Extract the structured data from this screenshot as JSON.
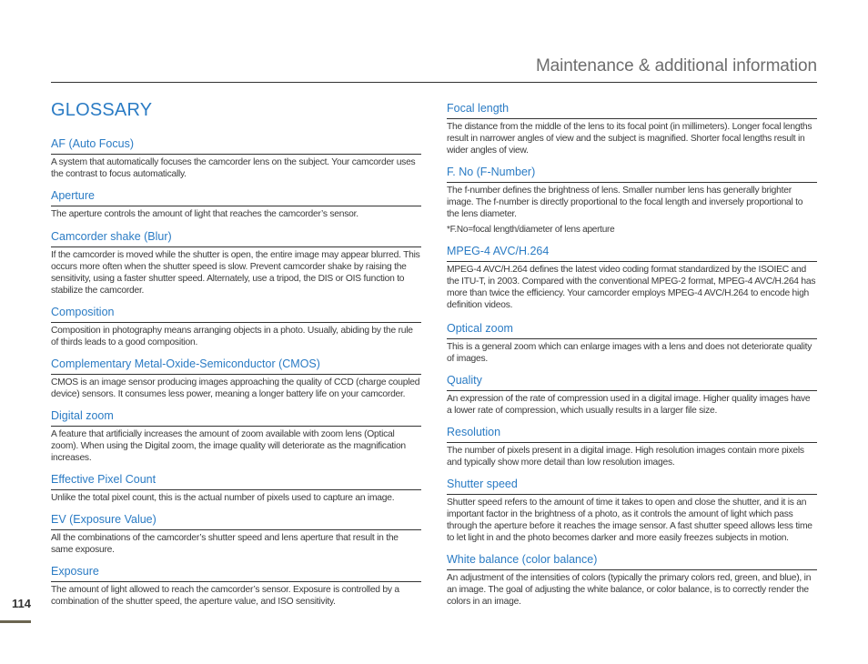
{
  "header": {
    "section_title": "Maintenance & additional information"
  },
  "page": {
    "title": "GLOSSARY",
    "number": "114"
  },
  "colors": {
    "accent_blue": "#2a7bc4",
    "header_gray": "#6d6d6d",
    "page_bar": "#6b6550"
  },
  "left_column": [
    {
      "term": "AF (Auto Focus)",
      "definition": "A system that automatically focuses the camcorder lens on the subject. Your camcorder uses the contrast to focus automatically."
    },
    {
      "term": "Aperture",
      "definition": "The aperture controls the amount of light that reaches the camcorder’s sensor."
    },
    {
      "term": "Camcorder shake (Blur)",
      "definition": "If the camcorder is moved while the shutter is open, the entire image may appear blurred. This occurs more often when the shutter speed is slow. Prevent camcorder shake by raising the sensitivity, using a faster shutter speed. Alternately, use a tripod, the DIS or OIS function to stabilize the camcorder."
    },
    {
      "term": "Composition",
      "definition": "Composition in photography means arranging objects in a photo. Usually, abiding by the rule of thirds leads to a good composition."
    },
    {
      "term": "Complementary Metal-Oxide-Semiconductor (CMOS)",
      "definition": "CMOS is an image sensor producing images approaching the quality of CCD (charge coupled device) sensors. It consumes less power, meaning a longer battery life on your camcorder."
    },
    {
      "term": "Digital zoom",
      "definition": "A feature that artificially increases the amount of zoom available with zoom lens (Optical zoom). When using the Digital zoom, the image quality will deteriorate as the magnification increases."
    },
    {
      "term": "Effective Pixel Count",
      "definition": "Unlike the total pixel count, this is the actual number of pixels used to capture an image."
    },
    {
      "term": "EV (Exposure Value)",
      "definition": "All the combinations of the camcorder’s shutter speed and lens aperture that result in the same exposure."
    },
    {
      "term": "Exposure",
      "definition": "The amount of light allowed to reach the camcorder’s sensor. Exposure is controlled by a combination of the shutter speed, the aperture value, and ISO sensitivity."
    }
  ],
  "right_column": [
    {
      "term": "Focal length",
      "definition": "The distance from the middle of the lens to its focal point (in millimeters). Longer focal lengths result in narrower angles of view and the subject is magnified. Shorter focal lengths result in wider angles of view."
    },
    {
      "term": "F. No (F-Number)",
      "definition": "The f-number defines the brightness of lens. Smaller number lens has generally brighter image. The f-number is directly proportional to the focal length and inversely proportional to the lens diameter.",
      "note": "*F.No=focal length/diameter of lens aperture"
    },
    {
      "term": "MPEG-4 AVC/H.264",
      "definition": "MPEG-4 AVC/H.264 defines the latest video coding format standardized by the ISOIEC and the ITU-T, in 2003. Compared with the conventional MPEG-2 format, MPEG-4 AVC/H.264 has more than twice the efficiency. Your camcorder employs MPEG-4 AVC/H.264 to encode high definition videos."
    },
    {
      "term": "Optical zoom",
      "definition": "This is a general zoom which can enlarge images with a lens and does not deteriorate quality of images."
    },
    {
      "term": "Quality",
      "definition": "An expression of the rate of compression used in a digital image. Higher quality images have a lower rate of compression, which usually results in a larger file size."
    },
    {
      "term": "Resolution",
      "definition": "The number of pixels present in a digital image. High resolution images contain more pixels and typically show more detail than low resolution images."
    },
    {
      "term": "Shutter speed",
      "definition": "Shutter speed refers to the amount of time it takes to open and close the shutter, and it is an important factor in the brightness of a photo, as it controls the amount of light which pass through the aperture before it reaches the image sensor. A fast shutter speed allows less time to let light in and the photo becomes darker and more easily freezes subjects in motion."
    },
    {
      "term": "White balance (color balance)",
      "definition": "An adjustment of the intensities of colors (typically the primary colors red, green, and blue), in an image. The goal of adjusting the white balance, or color balance, is to correctly render the colors in an image."
    }
  ]
}
